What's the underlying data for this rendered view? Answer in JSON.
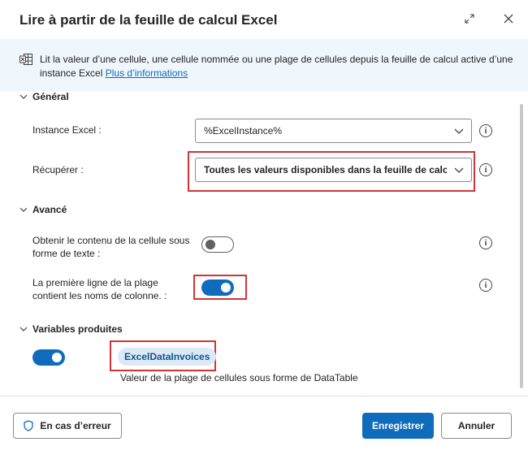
{
  "dialog": {
    "title": "Lire à partir de la feuille de calcul Excel",
    "info_text": "Lit la valeur d’une cellule, une cellule nommée ou une plage de cellules depuis la feuille de calcul active d’une instance Excel",
    "info_link": "Plus d’informations"
  },
  "general": {
    "section_label": "Général",
    "instance_label": "Instance Excel :",
    "instance_value": "%ExcelInstance%",
    "retrieve_label": "Récupérer :",
    "retrieve_value": "Toutes les valeurs disponibles dans la feuille de calcul"
  },
  "advanced": {
    "section_label": "Avancé",
    "as_text_label": "Obtenir le contenu de la cellule sous forme de texte :",
    "as_text_on": false,
    "header_row_label": "La première ligne de la plage contient les noms de colonne. :",
    "header_row_on": true
  },
  "variables": {
    "section_label": "Variables produites",
    "enabled": true,
    "name": "ExcelDataInvoices",
    "description": "Valeur de la plage de cellules sous forme de DataTable"
  },
  "footer": {
    "on_error_label": "En cas d’erreur",
    "save_label": "Enregistrer",
    "cancel_label": "Annuler"
  },
  "colors": {
    "accent": "#0f6cbd",
    "highlight": "#d13438",
    "info_background": "#eff6fc"
  },
  "icons": {
    "expand": "expand-icon",
    "close": "close-icon",
    "excel": "excel-icon",
    "chevron": "chevron-down-icon",
    "info": "info-icon",
    "shield": "shield-icon"
  }
}
